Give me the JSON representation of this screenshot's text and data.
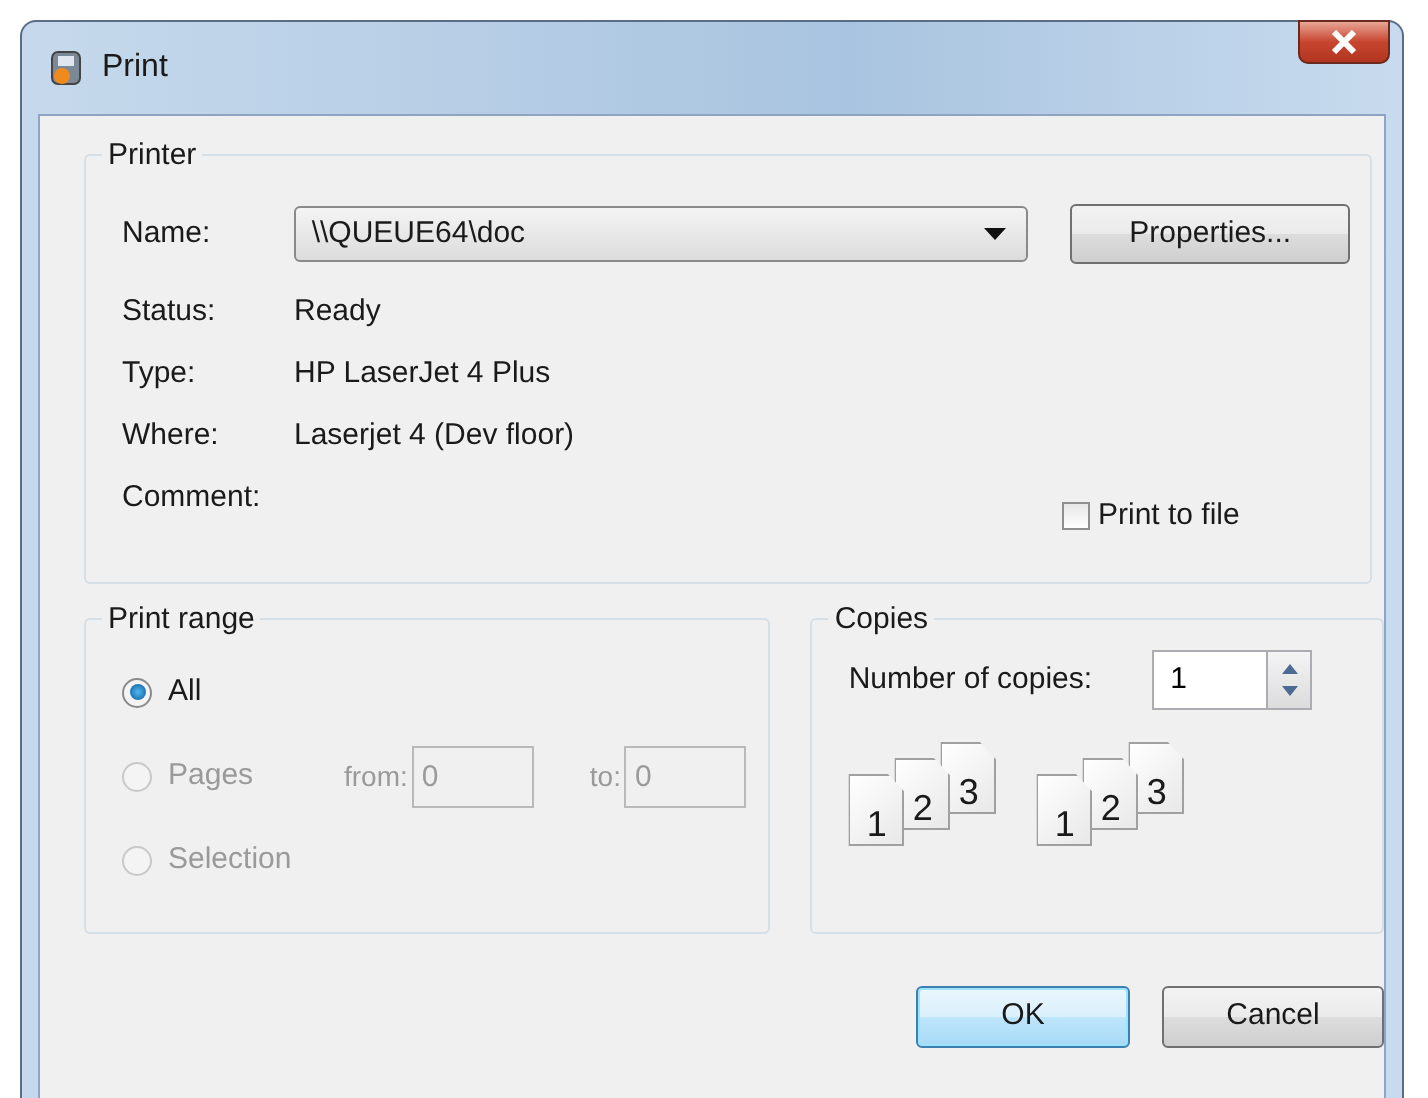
{
  "window": {
    "title": "Print"
  },
  "printer": {
    "title": "Printer",
    "name_label": "Name:",
    "name_value": "\\\\QUEUE64\\doc",
    "properties_button": "Properties...",
    "info": [
      {
        "label": "Status:",
        "value": "Ready"
      },
      {
        "label": "Type:",
        "value": "HP LaserJet 4 Plus"
      },
      {
        "label": "Where:",
        "value": "Laserjet 4 (Dev floor)"
      },
      {
        "label": "Comment:"
      }
    ],
    "print_to_file": {
      "label": "Print to file",
      "checked": false
    }
  },
  "print_range": {
    "title": "Print range",
    "options": [
      {
        "label": "All",
        "selected": true,
        "disabled": false
      },
      {
        "label": "Pages",
        "selected": false,
        "disabled": true
      },
      {
        "label": "Selection",
        "selected": false,
        "disabled": true
      }
    ],
    "from_label": "from:",
    "from_value": "0",
    "to_label": "to:",
    "to_value": "0"
  },
  "copies": {
    "title": "Copies",
    "number_label": "Number of copies:",
    "number_value": "1",
    "collate_sets": [
      [
        "1",
        "2",
        "3"
      ],
      [
        "1",
        "2",
        "3"
      ]
    ]
  },
  "buttons": [
    {
      "label": "OK",
      "default": true
    },
    {
      "label": "Cancel",
      "default": false
    }
  ]
}
